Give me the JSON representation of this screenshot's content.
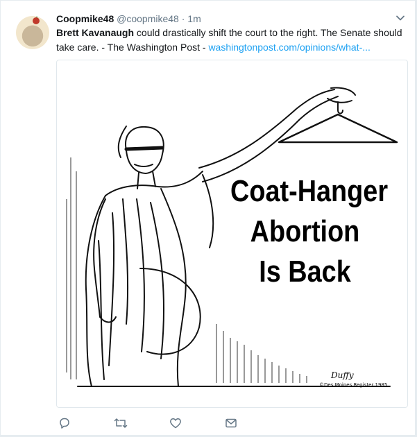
{
  "tweet": {
    "display_name": "Coopmike48",
    "handle": "@coopmike48",
    "separator": "·",
    "time": "1m",
    "text_bold": "Brett Kavanaugh",
    "text_body": " could drastically shift the court to the right. The Senate should take care. - The Washington Post - ",
    "link_text": "washingtonpost.com/opinions/what-..."
  },
  "media": {
    "caption_lines": [
      "Coat-Hanger",
      "Abortion",
      "Is Back"
    ],
    "signature": "Duffy",
    "credit": "©Des Moines Register 1985"
  },
  "actions": [
    {
      "name": "reply",
      "icon": "reply-icon"
    },
    {
      "name": "retweet",
      "icon": "retweet-icon"
    },
    {
      "name": "like",
      "icon": "heart-icon"
    },
    {
      "name": "dm",
      "icon": "envelope-icon"
    }
  ],
  "colors": {
    "link": "#1da1f2",
    "secondary": "#657786",
    "icon": "#657786"
  }
}
